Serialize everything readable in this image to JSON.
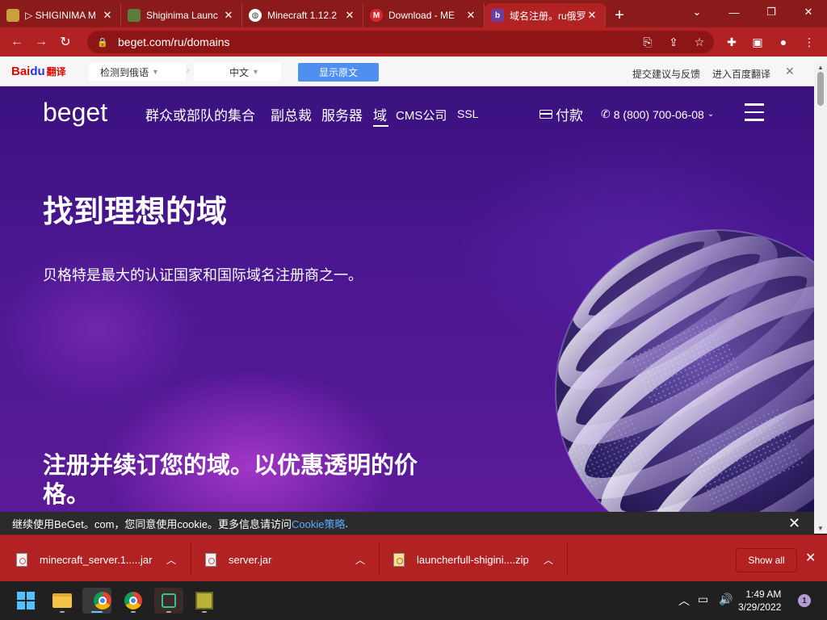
{
  "browser": {
    "tabs": [
      {
        "title": "▷ SHIGINIMA M",
        "favicon": "minecraft-block-icon",
        "favicon_color": "#c9a03a"
      },
      {
        "title": "Shiginima Launc",
        "favicon": "grass-block-icon",
        "favicon_color": "#5b7d3a"
      },
      {
        "title": "Minecraft 1.12.2",
        "favicon": "globe-icon",
        "favicon_color": "#ffffff"
      },
      {
        "title": "Download - ME",
        "favicon": "mega-icon",
        "favicon_color": "#d9272e"
      },
      {
        "title": "域名注册。ru俄罗",
        "favicon": "beget-icon",
        "favicon_color": "#6a3fa0"
      }
    ],
    "new_tab": "+",
    "url": "beget.com/ru/domains",
    "accent": "#b22222"
  },
  "baidu": {
    "logo_main": "Bai",
    "logo_du": "du",
    "logo_fanyi": "翻译",
    "detect_lang": "检测到俄语",
    "target_lang": "中文",
    "show_original": "显示原文",
    "feedback": "提交建议与反馈",
    "enter_baidu": "进入百度翻译"
  },
  "site": {
    "logo": "beget",
    "nav": [
      "群众或部队的集合",
      "副总裁",
      "服务器",
      "域",
      "CMS公司",
      "SSL"
    ],
    "pay": "付款",
    "phone": "8 (800) 700-06-08",
    "headline": "找到理想的域",
    "subtitle": "贝格特是最大的认证国家和国际域名注册商之一。",
    "section_title": "注册并续订您的域。以优惠透明的价格。"
  },
  "cookie": {
    "text": "继续使用BeGet。com，您同意使用cookie。更多信息请访问",
    "link": "Cookie策略",
    "end": "."
  },
  "downloads": {
    "items": [
      "minecraft_server.1.....jar",
      "server.jar",
      "launcherfull-shigini....zip"
    ],
    "show_all": "Show all"
  },
  "taskbar": {
    "time": "1:49 AM",
    "date": "3/29/2022",
    "notifications": "1"
  }
}
